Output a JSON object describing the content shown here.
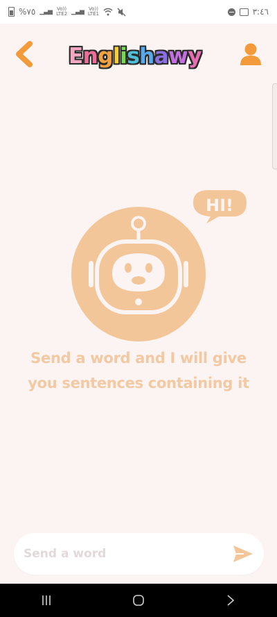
{
  "status_bar": {
    "battery": "%٧٥",
    "net1": [
      "Vo))",
      "LTE2"
    ],
    "net2": [
      "Vo))",
      "LTE1"
    ],
    "time": "٣:٤٦"
  },
  "app": {
    "title_letters": [
      "E",
      "n",
      "g",
      "l",
      "i",
      "s",
      "h",
      "a",
      "w",
      "y"
    ],
    "title_colors": [
      "#f0a7c0",
      "#ec6f9a",
      "#f2a23e",
      "#f4cf3a",
      "#7bd35a",
      "#4dc0d8",
      "#5aa8e8",
      "#8a6fe0",
      "#c46fe0",
      "#e56fb0"
    ]
  },
  "chat": {
    "bubble_text": "HI!",
    "hint": "Send a word and I will give you sentences containing it"
  },
  "input": {
    "placeholder": "Send a word",
    "value": ""
  },
  "colors": {
    "accent": "#f39a3a",
    "bot": "#f3c699",
    "background": "#fbf4f2",
    "hint": "#f3c9a3"
  }
}
